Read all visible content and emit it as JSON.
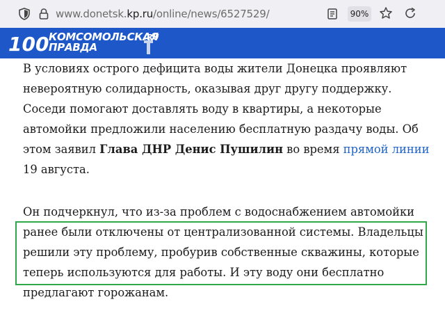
{
  "browser": {
    "url_prefix": "www.donetsk.",
    "url_host": "kp.ru",
    "url_path": "/online/news/6527529/",
    "zoom": "90%",
    "icons": [
      "shield-icon",
      "lock-icon",
      "reader-view-icon",
      "bookmark-star-icon",
      "reload-icon"
    ]
  },
  "site": {
    "logo_number": "100",
    "brand_line1": "КОМСОМОЛЬСКАЯ",
    "brand_line2": "ПРАВДА",
    "badge": ".RU",
    "brand_color": "#1e58c8"
  },
  "article": {
    "p1_text1": "В условиях острого дефицита воды жители Донецка проявляют невероятную солидарность, оказывая друг другу поддержку. Соседи помогают доставлять воду в квартиры, а некоторые автомойки предложили населению бесплатную раздачу воды. Об этом заявил ",
    "p1_bold": "Глава ДНР Денис Пушилин",
    "p1_text2": " во время ",
    "p1_link": "прямой линии",
    "p1_text3": " 19 августа.",
    "p2": "Он подчеркнул, что из-за проблем с водоснабжением автомойки ранее были отключены от централизованной системы. Владельцы решили эту проблему, пробурив собственные скважины, которые теперь используются для работы. И эту воду они бесплатно предлагают горожанам.",
    "link_color": "#1f63c8",
    "highlight_color": "#2fa84a"
  }
}
